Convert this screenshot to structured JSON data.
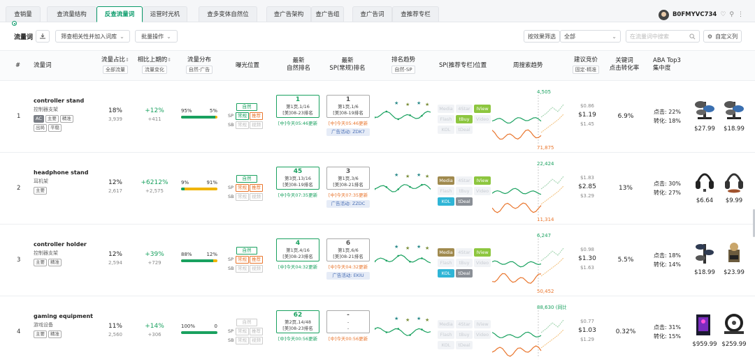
{
  "tabs": [
    "查销量",
    "查流量结构",
    "反查流量词",
    "运营时光机",
    "查多变体自然位",
    "查广告架构",
    "查广告组",
    "查广告词",
    "查推荐专栏"
  ],
  "active_tab": "反查流量词",
  "user": {
    "name": "B0FMYVC734"
  },
  "toolbar": {
    "title": "流量词",
    "filter_btn": "筛查相关性并加入词库",
    "batch_btn": "批量操作",
    "effect_filter": "按效果筛选",
    "all_select": "全部",
    "search_placeholder": "在流量词中搜索",
    "custom_cols": "自定义列"
  },
  "headers": {
    "idx": "#",
    "keyword": "流量词",
    "share": "流量占比",
    "share_sub": "全部流量",
    "change": "相比上期的",
    "change_sub": "流量变化",
    "dist": "流量分布",
    "dist_sub": "自然-广告",
    "exposure": "曝光位置",
    "nat_rank_1": "最新",
    "nat_rank_2": "自然排名",
    "sp_rank_1": "最新",
    "sp_rank_2": "SP(常规)排名",
    "trend": "排名趋势",
    "trend_sub": "自然-SP",
    "sp_pos": "SP(推荐专栏)位置",
    "week": "周搜索趋势",
    "bid": "建议竞价",
    "bid_sub": "固定-精准",
    "conv_1": "关键词",
    "conv_2": "点击转化率",
    "aba_1": "ABA Top3",
    "aba_2": "集中度"
  },
  "exposure_labels": {
    "nat": "自然",
    "sp": "SP",
    "sb": "SB",
    "regular": "常规",
    "recommend": "推荐",
    "video": "视频"
  },
  "sp_buttons": [
    "Media",
    "4Star",
    "IView",
    "Flash",
    "tBuy",
    "Video",
    "KOL",
    "tDeal"
  ],
  "rows": [
    {
      "idx": "1",
      "keyword": "controller stand",
      "keyword_cn": "控制器支架",
      "tags": [
        "AC",
        "主要",
        "精准",
        "出局",
        "平稳"
      ],
      "share": "18%",
      "share_sub": "3,939",
      "change": "+12%",
      "change_sub": "+411",
      "dist_left": "95%",
      "dist_right": "5%",
      "dist_fill": 0.95,
      "exp_regular": "green",
      "exp_recommend": "orange",
      "nat_rank": "1",
      "nat_line1": "第1页,1/16",
      "nat_line2": "[美]08-23排名",
      "nat_upd": "[中]今天05:46更新",
      "sp_rank": "1",
      "sp_line1": "第1页,1/6",
      "sp_line2": "[美]08-19排名",
      "sp_upd": "[中]今天05:46更新",
      "ad": "广告活动: ZDK7",
      "sp_active": {
        "IView": "#8dc63f",
        "tBuy": "#8dc63f"
      },
      "week_top": "4,505",
      "week_bottom": "71,875",
      "bid_low": "$0.86",
      "bid_mid": "$1.19",
      "bid_high": "$1.45",
      "conv": "6.9%",
      "aba_click": "点击: 22%",
      "aba_conv": "转化: 18%",
      "prod1": "$27.99",
      "prod2": "$18.99"
    },
    {
      "idx": "2",
      "keyword": "headphone stand",
      "keyword_cn": "耳机架",
      "tags": [
        "主要"
      ],
      "share": "12%",
      "share_sub": "2,617",
      "change": "+6212%",
      "change_sub": "+2,575",
      "dist_left": "9%",
      "dist_right": "91%",
      "dist_fill": 0.09,
      "exp_regular": "orange",
      "exp_recommend": "orange",
      "nat_rank": "45",
      "nat_line1": "第3页,13/16",
      "nat_line2": "[美]08-19排名",
      "nat_upd": "[中]今天07:35更新",
      "sp_rank": "3",
      "sp_line1": "第1页,3/6",
      "sp_line2": "[美]08-21排名",
      "sp_upd": "[中]今天07:35更新",
      "ad": "广告活动: ZZDC",
      "sp_active": {
        "Media": "#a08a4e",
        "IView": "#8dc63f",
        "KOL": "#2fb5d6",
        "tDeal": "#8a8f96"
      },
      "week_top": "22,424",
      "week_bottom": "11,314",
      "bid_low": "$1.83",
      "bid_mid": "$2.85",
      "bid_high": "$3.29",
      "conv": "13%",
      "aba_click": "点击: 30%",
      "aba_conv": "转化: 27%",
      "prod1": "$6.64",
      "prod2": "$9.99"
    },
    {
      "idx": "3",
      "keyword": "controller holder",
      "keyword_cn": "控制器支架",
      "tags": [
        "主要",
        "精准"
      ],
      "share": "12%",
      "share_sub": "2,594",
      "change": "+39%",
      "change_sub": "+729",
      "dist_left": "88%",
      "dist_right": "12%",
      "dist_fill": 0.88,
      "exp_regular": "orange",
      "exp_recommend": "orange",
      "nat_rank": "4",
      "nat_line1": "第1页,4/16",
      "nat_line2": "[美]08-23排名",
      "nat_upd": "[中]今天04:32更新",
      "sp_rank": "6",
      "sp_line1": "第1页,6/6",
      "sp_line2": "[美]08-21排名",
      "sp_upd": "[中]今天04:32更新",
      "ad": "广告活动: EKIU",
      "sp_active": {
        "Media": "#a08a4e",
        "IView": "#8dc63f",
        "KOL": "#2fb5d6",
        "tDeal": "#8a8f96"
      },
      "week_top": "6,247",
      "week_bottom": "50,452",
      "bid_low": "$0.98",
      "bid_mid": "$1.30",
      "bid_high": "$1.63",
      "conv": "5.5%",
      "aba_click": "点击: 18%",
      "aba_conv": "转化: 14%",
      "prod1": "$18.99",
      "prod2": "$23.99"
    },
    {
      "idx": "4",
      "keyword": "gaming equipment",
      "keyword_cn": "游戏设备",
      "tags": [
        "主要",
        "精准"
      ],
      "share": "11%",
      "share_sub": "2,560",
      "change": "+14%",
      "change_sub": "+306",
      "dist_left": "100%",
      "dist_right": "0",
      "dist_fill": 1.0,
      "exp_regular": "grey",
      "exp_recommend": "grey",
      "nat_rank": "62",
      "nat_line1": "第2页,14/48",
      "nat_line2": "[美]08-23排名",
      "nat_upd": "[中]今天00:56更新",
      "sp_rank": "-",
      "sp_line1": "-",
      "sp_line2": "-",
      "sp_upd": "[中]今天00:56更新",
      "ad": "",
      "sp_active": {},
      "week_top": "88,630 (同比↑63%↑)",
      "week_bottom": "1,682",
      "bid_low": "$0.77",
      "bid_mid": "$1.03",
      "bid_high": "$1.29",
      "conv": "0.32%",
      "aba_click": "点击: 31%",
      "aba_conv": "转化: 15%",
      "prod1": "$959.99",
      "prod2": "$259.99"
    }
  ],
  "colors": {
    "green": "#19a15f",
    "orange": "#e9752c",
    "gold": "#f0b400",
    "accent": "#0a9b6a"
  }
}
